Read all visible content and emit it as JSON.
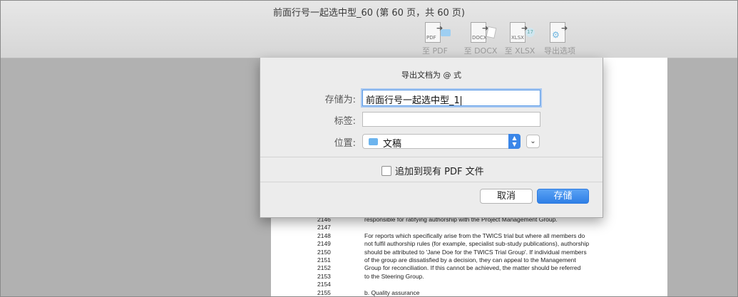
{
  "window": {
    "title": "前面行号一起选中型_60 (第 60 页，共 60 页)"
  },
  "toolbar": {
    "buttons": [
      {
        "label": "至 PDF",
        "doc_tag": "PDF",
        "icon": "export-pdf-icon"
      },
      {
        "label": "至 DOCX",
        "doc_tag": "DOCX",
        "icon": "export-docx-icon"
      },
      {
        "label": "至 XLSX",
        "doc_tag": "XLSX",
        "icon": "export-xlsx-icon"
      },
      {
        "label": "导出选项",
        "doc_tag": "",
        "icon": "export-options-icon"
      }
    ]
  },
  "dialog": {
    "title": "导出文档为 @ 式",
    "save_as_label": "存储为:",
    "save_as_value": "前面行号一起选中型_1",
    "tags_label": "标签:",
    "tags_value": "",
    "location_label": "位置:",
    "location_value": "文稿",
    "append_label": "追加到现有 PDF 文件",
    "append_checked": false,
    "cancel_label": "取消",
    "save_label": "存储"
  },
  "document": {
    "lines": [
      {
        "n": "2146",
        "t": "responsible for ratifying authorship with the Project Management Group."
      },
      {
        "n": "2147",
        "t": ""
      },
      {
        "n": "2148",
        "t": "For reports which specifically arise from the TWICS trial but where all members do"
      },
      {
        "n": "2149",
        "t": "not fulfil authorship rules (for example, specialist sub-study publications), authorship"
      },
      {
        "n": "2150",
        "t": "should be attributed to 'Jane Doe for the TWICS Trial Group'.  If individual members"
      },
      {
        "n": "2151",
        "t": "of the group are dissatisfied by a decision, they can appeal to the Management"
      },
      {
        "n": "2152",
        "t": "Group for reconciliation.  If this cannot be achieved, the matter should be referred"
      },
      {
        "n": "2153",
        "t": "to the Steering Group."
      },
      {
        "n": "2154",
        "t": ""
      },
      {
        "n": "2155",
        "t": "b.   Quality assurance"
      }
    ]
  }
}
